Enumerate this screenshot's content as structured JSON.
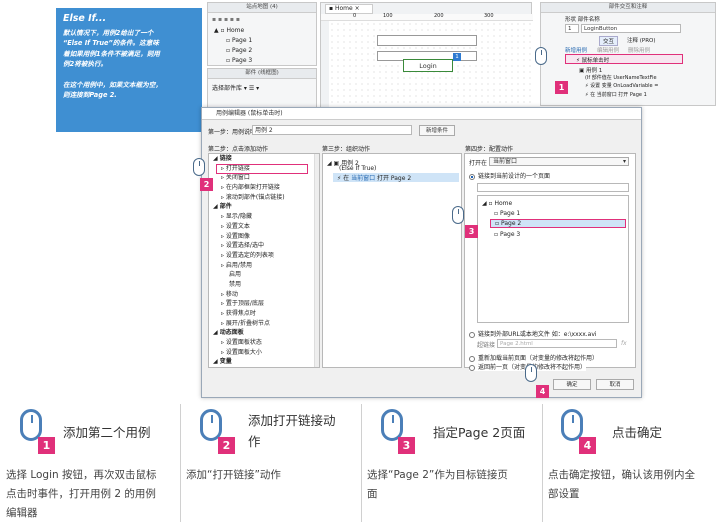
{
  "note": {
    "title": "Else If...",
    "lines": [
      "默认情况下，用例2给出了一个",
      "“Else If True”的条件。这意味",
      "着如果用例1条件不被满足，则用",
      "例2将被执行。",
      "",
      "在这个用例中，如果文本框为空，",
      "则连接到Page 2."
    ]
  },
  "sitemap": {
    "title": "站点地图 (4)",
    "home": "Home",
    "pages": [
      "Page 1",
      "Page 2",
      "Page 3"
    ]
  },
  "widgets": {
    "title": "部件 (线框图)",
    "filter": "选择部件库"
  },
  "home_tab": "Home",
  "canvas": {
    "ruler": [
      "0",
      "100",
      "200",
      "300"
    ],
    "login": "Login",
    "badge": "1"
  },
  "inspector": {
    "title": "部件交互和注释",
    "shape_label": "形状 部件名称",
    "shape_value": "1",
    "name_value": "LoginButton",
    "tabs": [
      "交互",
      "注释 (PRO)"
    ],
    "subtabs": [
      "新增用例",
      "编辑用例",
      "删除用例"
    ],
    "event": "鼠标单击时",
    "case1": "用例 1",
    "case1_cond": "(If 部件值在 UserNameTextFie",
    "case1_a1": "设置 变量 OnLoadVariable =",
    "case1_a2": "在 当前窗口 打开 Page 1"
  },
  "dialog": {
    "title": "用例编辑器 (鼠标单击时)",
    "step1_label": "第一步：用例说明",
    "case_name": "用例 2",
    "add_condition": "新增条件",
    "step2": "第二步：点击添加动作",
    "step3": "第三步：组织动作",
    "step4": "第四步：配置动作",
    "actions": [
      {
        "label": "链接",
        "lvl": 0,
        "bold": true
      },
      {
        "label": "打开链接",
        "lvl": 1
      },
      {
        "label": "关闭窗口",
        "lvl": 1
      },
      {
        "label": "在内部框架打开链接",
        "lvl": 1
      },
      {
        "label": "滚动到部件(锚点链接)",
        "lvl": 1
      },
      {
        "label": "部件",
        "lvl": 0,
        "bold": true
      },
      {
        "label": "显示/隐藏",
        "lvl": 1
      },
      {
        "label": "设置文本",
        "lvl": 1
      },
      {
        "label": "设置图像",
        "lvl": 1
      },
      {
        "label": "设置选择/选中",
        "lvl": 1
      },
      {
        "label": "设置选定的列表项",
        "lvl": 1
      },
      {
        "label": "启用/禁用",
        "lvl": 1
      },
      {
        "label": "启用",
        "lvl": 2
      },
      {
        "label": "禁用",
        "lvl": 2
      },
      {
        "label": "移动",
        "lvl": 1
      },
      {
        "label": "置于顶层/底层",
        "lvl": 1
      },
      {
        "label": "获得焦点时",
        "lvl": 1
      },
      {
        "label": "展开/折叠树节点",
        "lvl": 1
      },
      {
        "label": "动态面板",
        "lvl": 0,
        "bold": true
      },
      {
        "label": "设置面板状态",
        "lvl": 1
      },
      {
        "label": "设置面板大小",
        "lvl": 1
      },
      {
        "label": "变量",
        "lvl": 0,
        "bold": true
      }
    ],
    "org_case": "用例 2",
    "org_cond": "(Else If True)",
    "org_action_prefix": "在",
    "org_action_win": "当前窗口",
    "org_action_rest": "打开 Page 2",
    "open_in_label": "打开在",
    "open_in_value": "当前窗口",
    "radio1": "链接到当前设计的一个页面",
    "tree_home": "Home",
    "tree_pages": [
      "Page 1",
      "Page 2",
      "Page 3"
    ],
    "radio2": "链接到外部URL或本地文件 如：e:\\xxxx.avi",
    "hyperlink_label": "超链接",
    "hyperlink_placeholder": "Page 2.html",
    "fx": "fx",
    "radio3": "重新加载当前页面（对变量的修改将起作用）",
    "radio4": "返回前一页（对变量的修改将不起作用）",
    "ok": "确定",
    "cancel": "取消"
  },
  "steps": [
    {
      "num": "1",
      "title": "添加第二个用例",
      "desc": [
        "选择 Login 按钮，再次双击鼠标",
        "点击时事件，打开用例 2 的用例",
        "编辑器"
      ]
    },
    {
      "num": "2",
      "title": "添加打开链接动",
      "title2": "作",
      "desc": [
        "添加“打开链接”动作"
      ]
    },
    {
      "num": "3",
      "title": "指定Page 2页面",
      "desc": [
        "选择“Page 2”作为目标链接页",
        "面"
      ]
    },
    {
      "num": "4",
      "title": "点击确定",
      "desc": [
        "点击确定按钮，确认该用例内全",
        "部设置"
      ]
    }
  ],
  "colors": {
    "accent": "#e0307a",
    "note_bg": "#3f8fd2",
    "selection": "#cfe4f7"
  }
}
